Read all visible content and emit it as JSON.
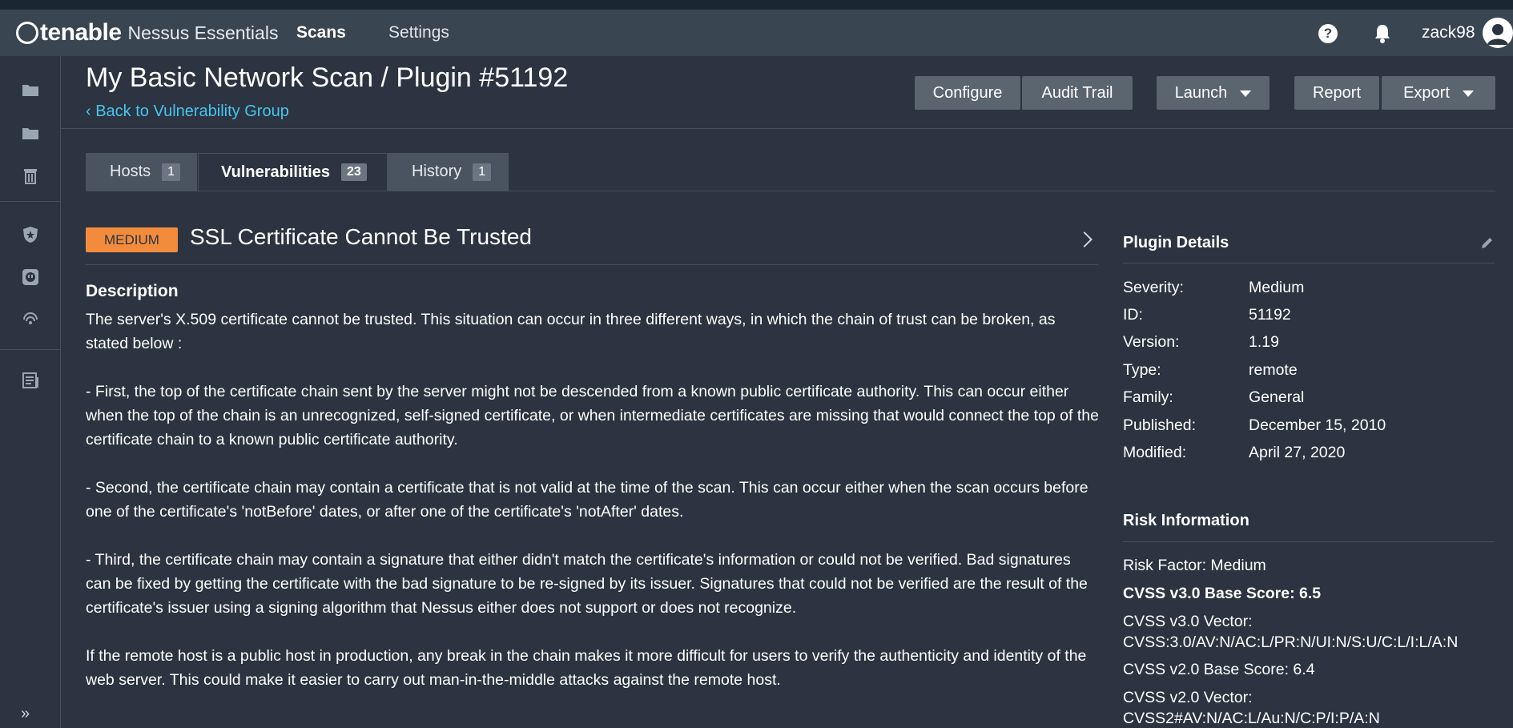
{
  "app": {
    "brand": "tenable",
    "product": "Nessus Essentials"
  },
  "nav": {
    "scans": "Scans",
    "settings": "Settings",
    "username": "zack98"
  },
  "header": {
    "title": "My Basic Network Scan / Plugin #51192",
    "back_link": "Back to Vulnerability Group",
    "buttons": {
      "configure": "Configure",
      "audit_trail": "Audit Trail",
      "launch": "Launch",
      "report": "Report",
      "export": "Export"
    }
  },
  "tabs": [
    {
      "label": "Hosts",
      "count": "1"
    },
    {
      "label": "Vulnerabilities",
      "count": "23"
    },
    {
      "label": "History",
      "count": "1"
    }
  ],
  "vuln": {
    "severity": "MEDIUM",
    "severity_color": "#f28c3c",
    "title": "SSL Certificate Cannot Be Trusted",
    "description_heading": "Description",
    "paragraphs": [
      "The server's X.509 certificate cannot be trusted. This situation can occur in three different ways, in which the chain of trust can be broken, as stated below :",
      "- First, the top of the certificate chain sent by the server might not be descended from a known public certificate authority. This can occur either when the top of the chain is an unrecognized, self-signed certificate, or when intermediate certificates are missing that would connect the top of the certificate chain to a known public certificate authority.",
      "- Second, the certificate chain may contain a certificate that is not valid at the time of the scan. This can occur either when the scan occurs before one of the certificate's 'notBefore' dates, or after one of the certificate's 'notAfter' dates.",
      "- Third, the certificate chain may contain a signature that either didn't match the certificate's information or could not be verified. Bad signatures can be fixed by getting the certificate with the bad signature to be re-signed by its issuer. Signatures that could not be verified are the result of the certificate's issuer using a signing algorithm that Nessus either does not support or does not recognize.",
      "If the remote host is a public host in production, any break in the chain makes it more difficult for users to verify the authenticity and identity of the web server. This could make it easier to carry out man-in-the-middle attacks against the remote host."
    ]
  },
  "plugin_details": {
    "heading": "Plugin Details",
    "rows": [
      {
        "key": "Severity:",
        "value": "Medium"
      },
      {
        "key": "ID:",
        "value": "51192"
      },
      {
        "key": "Version:",
        "value": "1.19"
      },
      {
        "key": "Type:",
        "value": "remote"
      },
      {
        "key": "Family:",
        "value": "General"
      },
      {
        "key": "Published:",
        "value": "December 15, 2010"
      },
      {
        "key": "Modified:",
        "value": "April 27, 2020"
      }
    ]
  },
  "risk_info": {
    "heading": "Risk Information",
    "risk_factor": "Risk Factor: Medium",
    "cvss3_score": "CVSS v3.0 Base Score: 6.5",
    "cvss3_vector_label": "CVSS v3.0 Vector:",
    "cvss3_vector": "CVSS:3.0/AV:N/AC:L/PR:N/UI:N/S:U/C:L/I:L/A:N",
    "cvss2_score": "CVSS v2.0 Base Score: 6.4",
    "cvss2_vector_label": "CVSS v2.0 Vector:",
    "cvss2_vector": "CVSS2#AV:N/AC:L/Au:N/C:P/I:P/A:N"
  },
  "icons": {
    "help": "help-icon",
    "bell": "bell-icon",
    "avatar": "user-avatar-icon",
    "sidebar": [
      "folder-icon",
      "folder-icon",
      "trash-icon",
      "shield-star-icon",
      "plugin-icon",
      "radar-icon",
      "report-list-icon",
      "expand-icon"
    ]
  }
}
